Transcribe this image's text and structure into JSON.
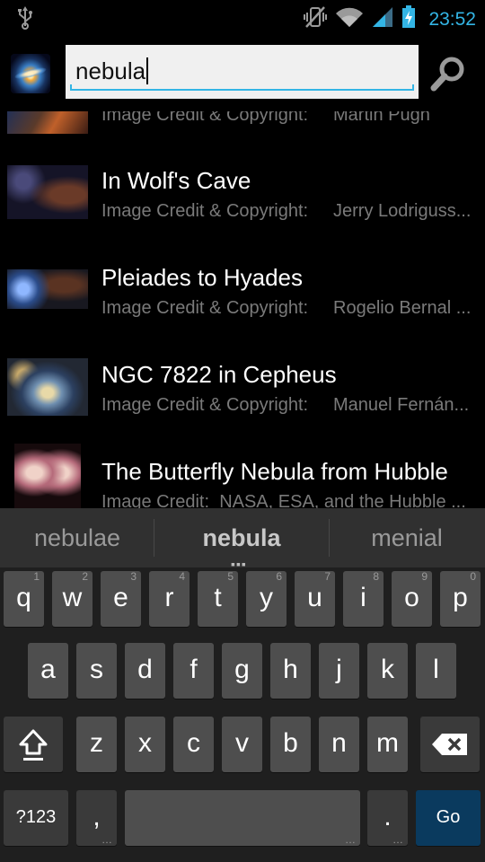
{
  "status_bar": {
    "time": "23:52",
    "icons": [
      "usb-icon",
      "vibrate-mute-icon",
      "wifi-icon",
      "signal-icon",
      "battery-charging-icon"
    ]
  },
  "search": {
    "query": "nebula",
    "icon": "search-icon"
  },
  "results": [
    {
      "title": "",
      "credit_label": "Image Credit & Copyright:",
      "credit_name": "Martin Pugh"
    },
    {
      "title": "In Wolf's Cave",
      "credit_label": "Image Credit & Copyright:",
      "credit_name": "Jerry Lodriguss..."
    },
    {
      "title": "Pleiades to Hyades",
      "credit_label": "Image Credit & Copyright:",
      "credit_name": "Rogelio Bernal ..."
    },
    {
      "title": "NGC 7822 in Cepheus",
      "credit_label": "Image Credit & Copyright:",
      "credit_name": "Manuel Fernán..."
    },
    {
      "title": "The Butterfly Nebula from Hubble",
      "credit_label": "Image Credit:",
      "credit_name": "NASA, ESA, and the  Hubble ..."
    }
  ],
  "keyboard": {
    "suggestions": [
      "nebulae",
      "nebula",
      "menial"
    ],
    "row1": [
      {
        "label": "q",
        "hint": "1"
      },
      {
        "label": "w",
        "hint": "2"
      },
      {
        "label": "e",
        "hint": "3"
      },
      {
        "label": "r",
        "hint": "4"
      },
      {
        "label": "t",
        "hint": "5"
      },
      {
        "label": "y",
        "hint": "6"
      },
      {
        "label": "u",
        "hint": "7"
      },
      {
        "label": "i",
        "hint": "8"
      },
      {
        "label": "o",
        "hint": "9"
      },
      {
        "label": "p",
        "hint": "0"
      }
    ],
    "row2": [
      "a",
      "s",
      "d",
      "f",
      "g",
      "h",
      "j",
      "k",
      "l"
    ],
    "row3": [
      "z",
      "x",
      "c",
      "v",
      "b",
      "n",
      "m"
    ],
    "symbols_label": "?123",
    "comma_label": ",",
    "period_label": ".",
    "go_label": "Go",
    "shift_icon": "shift-icon",
    "backspace_icon": "backspace-icon"
  }
}
